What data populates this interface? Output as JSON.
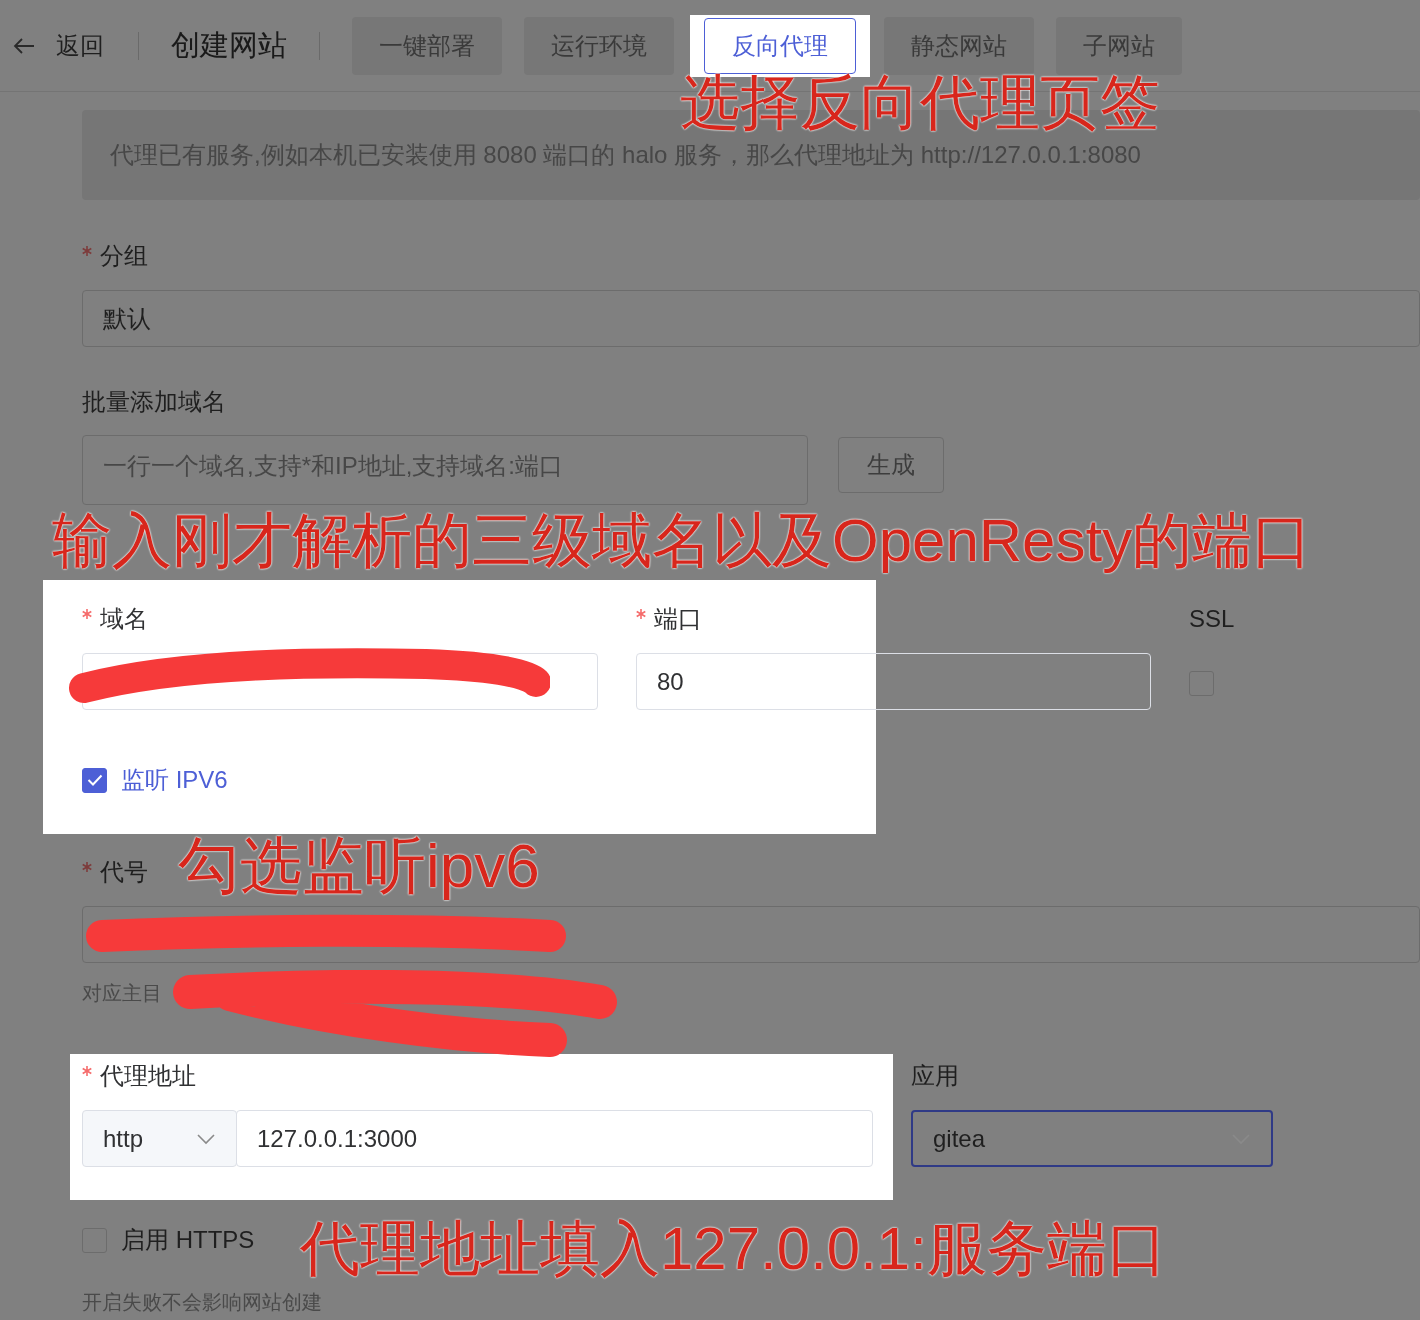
{
  "header": {
    "back_label": "返回",
    "title": "创建网站"
  },
  "tabs": [
    {
      "label": "一键部署",
      "selected": false
    },
    {
      "label": "运行环境",
      "selected": false
    },
    {
      "label": "反向代理",
      "selected": true
    },
    {
      "label": "静态网站",
      "selected": false
    },
    {
      "label": "子网站",
      "selected": false
    }
  ],
  "info_banner": "代理已有服务,例如本机已安装使用 8080 端口的 halo 服务，那么代理地址为 http://127.0.0.1:8080",
  "group": {
    "label": "分组",
    "required": true,
    "value": "默认"
  },
  "batch_domains": {
    "label": "批量添加域名",
    "placeholder": "一行一个域名,支持*和IP地址,支持域名:端口",
    "button": "生成"
  },
  "domain_section": {
    "highlighted": true,
    "domain": {
      "label": "域名",
      "required": true
    },
    "port": {
      "label": "端口",
      "required": true,
      "value": "80"
    },
    "ssl": {
      "label": "SSL",
      "checked": false
    },
    "ipv6": {
      "label": "监听 IPV6",
      "checked": true
    }
  },
  "alias": {
    "label": "代号",
    "required": true,
    "hint": "对应主目"
  },
  "proxy_section": {
    "highlighted": true,
    "label": "代理地址",
    "required": true,
    "protocol": "http",
    "address": "127.0.0.1:3000",
    "app": {
      "label": "应用",
      "value": "gitea",
      "focused": true
    }
  },
  "https": {
    "label": "启用 HTTPS",
    "checked": false,
    "hint": "开启失败不会影响网站创建"
  },
  "annotations": [
    {
      "text": "选择反向代理页签"
    },
    {
      "text": "输入刚才解析的三级域名以及OpenResty的端口"
    },
    {
      "text": "勾选监听ipv6"
    },
    {
      "text": "代理地址填入127.0.0.1:服务端口"
    }
  ]
}
